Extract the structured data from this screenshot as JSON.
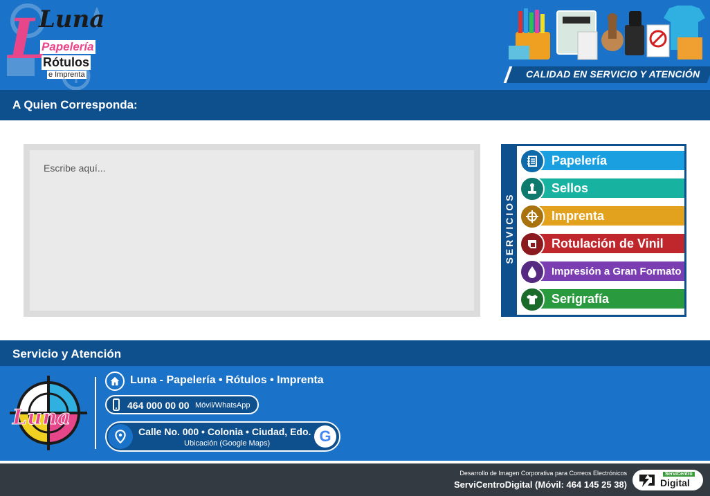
{
  "header": {
    "logo": {
      "luna": "Luna",
      "papeleria": "Papelería",
      "rotulos": "Rótulos",
      "imprenta": "e Imprenta"
    },
    "tagline": "CALIDAD EN SERVICIO Y ATENCIÓN"
  },
  "greeting_bar": {
    "title": "A Quien Corresponda:"
  },
  "message": {
    "placeholder": "Escribe aquí...",
    "value": ""
  },
  "services": {
    "label": "SERVICIOS",
    "items": [
      {
        "label": "Papelería",
        "icon": "notebook-icon",
        "color": "#1aa0e0"
      },
      {
        "label": "Sellos",
        "icon": "stamp-icon",
        "color": "#18b2a0"
      },
      {
        "label": "Imprenta",
        "icon": "crosshair-icon",
        "color": "#e2a21e"
      },
      {
        "label": "Rotulación de Vinil",
        "icon": "vinyl-cut-icon",
        "color": "#c0272d"
      },
      {
        "label": "Impresión a Gran Formato",
        "icon": "ink-drop-icon",
        "color": "#7a3eb2"
      },
      {
        "label": "Serigrafía",
        "icon": "tshirt-icon",
        "color": "#2a9a3e"
      }
    ]
  },
  "contact_bar": {
    "title": "Servicio y Atención"
  },
  "contact": {
    "company": "Luna - Papelería • Rótulos • Imprenta",
    "phone": "464 000 00 00",
    "phone_note": "Móvil/WhatsApp",
    "address": "Calle No. 000 • Colonia • Ciudad, Edo.",
    "address_note": "Ubicación (Google Maps)",
    "google_letter": "G",
    "logo_text": "Luna"
  },
  "footer": {
    "small": "Desarrollo de Imagen Corporativa para Correos Electrónicos",
    "big": "ServiCentroDigital (Móvil: 464 145 25 38)",
    "badge_top": "ServiCentro",
    "badge_bottom": "Digital"
  },
  "colors": {
    "primary_blue": "#1a73c8",
    "dark_blue": "#0e4f8e",
    "footer_gray": "#343a42",
    "pink": "#e8468a"
  }
}
